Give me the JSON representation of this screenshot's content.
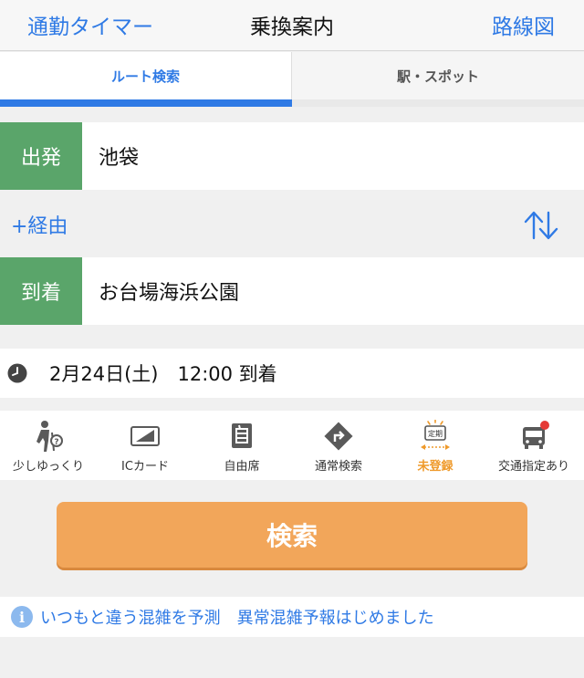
{
  "nav": {
    "left": "通勤タイマー",
    "title": "乗換案内",
    "right": "路線図"
  },
  "tabs": {
    "active": "ルート検索",
    "inactive": "駅・スポット"
  },
  "departure": {
    "label": "出発",
    "value": "池袋"
  },
  "via": {
    "label": "+経由",
    "swap_icon": "swap-arrows-icon"
  },
  "arrival": {
    "label": "到着",
    "value": "お台場海浜公園"
  },
  "datetime": {
    "icon": "clock-icon",
    "value": "2月24日(土)　12:00 到着"
  },
  "options": [
    {
      "label": "少しゆっくり",
      "icon": "walking-person-icon"
    },
    {
      "label": "ICカード",
      "icon": "ic-card-icon"
    },
    {
      "label": "自由席",
      "icon": "reserved-seat-icon"
    },
    {
      "label": "通常検索",
      "icon": "route-sign-icon"
    },
    {
      "label": "未登録",
      "icon": "commuter-pass-icon",
      "badge": "定期"
    },
    {
      "label": "交通指定あり",
      "icon": "bus-icon"
    }
  ],
  "search_button": "検索",
  "notice": {
    "icon": "i",
    "text": "いつもと違う混雑を予測　異常混雑予報はじめました"
  },
  "colors": {
    "accent": "#2f7ae5",
    "label_green": "#5aa56a",
    "search_orange": "#f2a65a",
    "warning_orange": "#ef9a2b",
    "badge_red": "#e53935"
  }
}
